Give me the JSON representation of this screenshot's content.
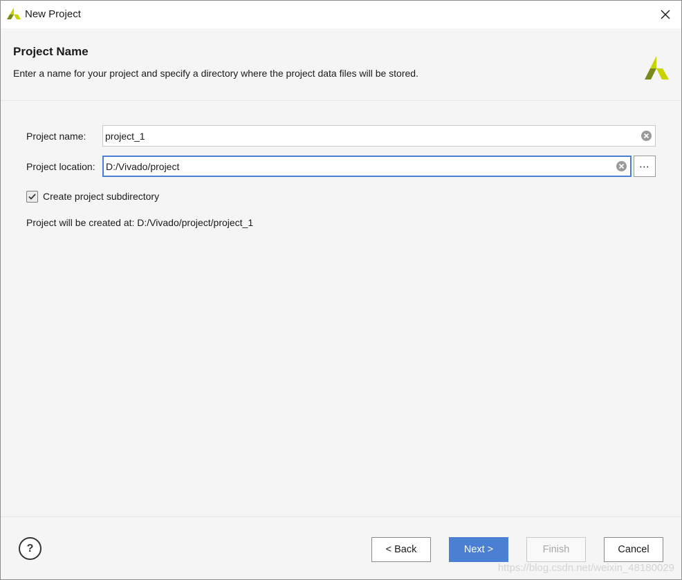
{
  "window": {
    "title": "New Project",
    "close_icon": "close-icon"
  },
  "header": {
    "heading": "Project Name",
    "description": "Enter a name for your project and specify a directory where the project data files will be stored."
  },
  "form": {
    "project_name_label": "Project name:",
    "project_name_value": "project_1",
    "project_location_label": "Project location:",
    "project_location_value": "D:/Vivado/project",
    "browse_label": "⋯",
    "subdirectory_label": "Create project subdirectory",
    "subdirectory_checked": true,
    "created_at_text": "Project will be created at: D:/Vivado/project/project_1"
  },
  "footer": {
    "help_label": "?",
    "back_label": "< Back",
    "next_label": "Next >",
    "finish_label": "Finish",
    "cancel_label": "Cancel"
  },
  "watermark": "https://blog.csdn.net/weixin_48180029",
  "colors": {
    "accent": "#4a7fd4",
    "logo_light": "#c8d400",
    "logo_dark": "#7a8a1a"
  }
}
